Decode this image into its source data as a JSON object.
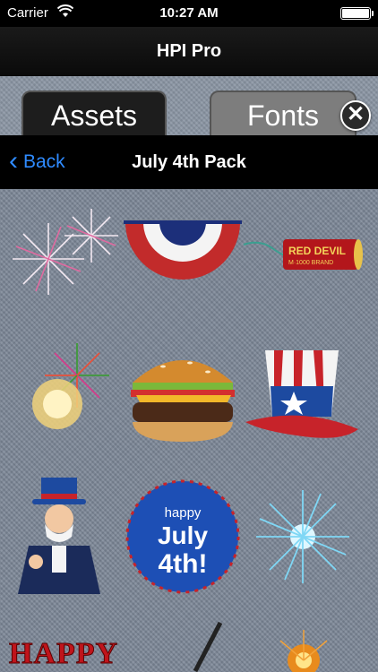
{
  "status": {
    "carrier": "Carrier",
    "time": "10:27 AM"
  },
  "title": "HPI Pro",
  "tabs": {
    "assets": "Assets",
    "fonts": "Fonts"
  },
  "nav": {
    "back": "Back",
    "title": "July 4th Pack"
  },
  "assets": {
    "firecracker_text": "RED DEVIL",
    "firecracker_sub": "M·1000 BRAND",
    "badge_line1": "happy",
    "badge_line2": "July",
    "badge_line3": "4th!",
    "happy_text": "HAPPY"
  },
  "colors": {
    "accent": "#2f8bff",
    "denim": "#7c8797"
  },
  "icons": [
    "wifi-icon",
    "battery-icon",
    "close-icon",
    "chevron-left-icon"
  ]
}
